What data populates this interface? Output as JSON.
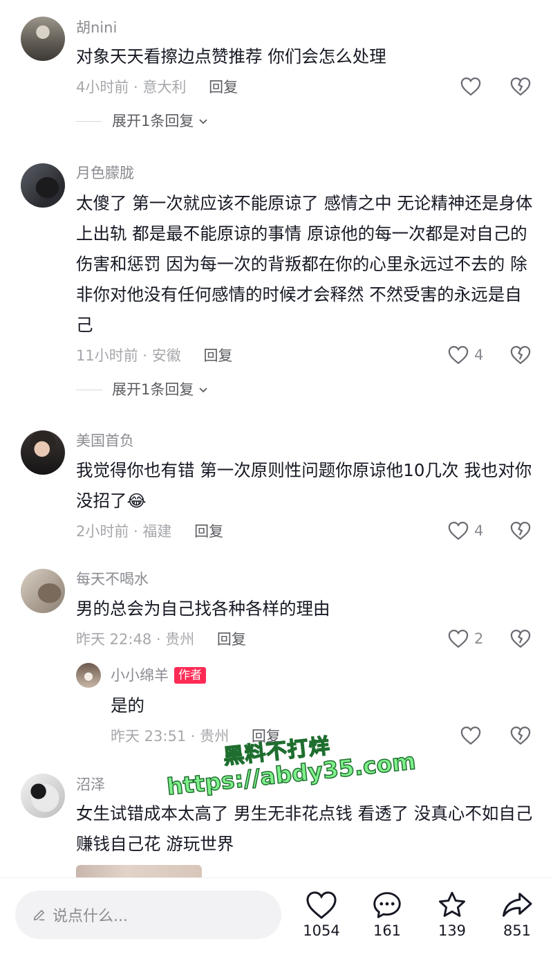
{
  "comments": [
    {
      "username": "胡nini",
      "text": "对象天天看擦边点赞推荐 你们会怎么处理",
      "meta": "4小时前 · 意大利",
      "reply_label": "回复",
      "likes": "",
      "expand_label": "展开1条回复"
    },
    {
      "username": "月色朦胧",
      "text": "太傻了 第一次就应该不能原谅了 感情之中 无论精神还是身体上出轨 都是最不能原谅的事情 原谅他的每一次都是对自己的伤害和惩罚 因为每一次的背叛都在你的心里永远过不去的 除非你对他没有任何感情的时候才会释然 不然受害的永远是自己",
      "meta": "11小时前 · 安徽",
      "reply_label": "回复",
      "likes": "4",
      "expand_label": "展开1条回复"
    },
    {
      "username": "美国首负",
      "text": "我觉得你也有错 第一次原则性问题你原谅他10几次 我也对你没招了",
      "emoji": "😂",
      "meta": "2小时前 · 福建",
      "reply_label": "回复",
      "likes": "4"
    },
    {
      "username": "每天不喝水",
      "text": "男的总会为自己找各种各样的理由",
      "meta": "昨天 22:48 · 贵州",
      "reply_label": "回复",
      "likes": "2",
      "reply": {
        "username": "小小绵羊",
        "author_tag": "作者",
        "text": "是的",
        "meta": "昨天 23:51 · 贵州",
        "reply_label": "回复"
      }
    },
    {
      "username": "沼泽",
      "text": "女生试错成本太高了 男生无非花点钱 看透了 没真心不如自己赚钱自己花 游玩世界"
    }
  ],
  "watermark": {
    "line1": "黑料不打烊",
    "line2": "https://abdy35.com"
  },
  "bottom_bar": {
    "input_placeholder": "说点什么...",
    "like_count": "1054",
    "comment_count": "161",
    "favorite_count": "139",
    "share_count": "851"
  },
  "colors": {
    "accent": "#fe2c55",
    "text": "#161823",
    "secondary": "#8a8b91"
  },
  "icons": [
    "heart-icon",
    "broken-heart-icon",
    "chevron-down-icon",
    "pencil-icon",
    "comment-icon",
    "star-icon",
    "share-icon"
  ]
}
